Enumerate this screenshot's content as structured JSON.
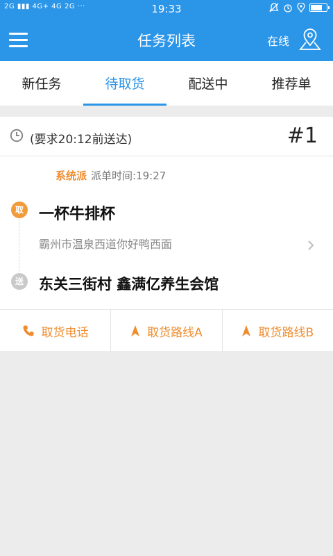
{
  "status_bar": {
    "network_left": "2G",
    "network_mid": "4G+ 4G",
    "network_right": "2G",
    "dots": "···",
    "time": "19:33",
    "battery_level": 0.75
  },
  "header": {
    "title": "任务列表",
    "online_label": "在线"
  },
  "tabs": [
    {
      "label": "新任务",
      "active": false
    },
    {
      "label": "待取货",
      "active": true
    },
    {
      "label": "配送中",
      "active": false
    },
    {
      "label": "推荐单",
      "active": false
    }
  ],
  "order": {
    "deadline": "(要求20:12前送达)",
    "number": "#1",
    "source": "系统派",
    "dispatch_time": "派单时间:19:27",
    "pickup_badge": "取",
    "shop_name": "一杯牛排杯",
    "shop_address": "霸州市温泉西道你好鸭西面",
    "deliver_badge": "送",
    "destination": "东关三街村 鑫满亿养生会馆"
  },
  "actions": {
    "call": "取货电话",
    "route_a": "取货路线A",
    "route_b": "取货路线B"
  },
  "colors": {
    "primary": "#2b95e8",
    "accent": "#ef8c2e",
    "pickup": "#f29b3b",
    "deliver": "#c9c9c9"
  }
}
